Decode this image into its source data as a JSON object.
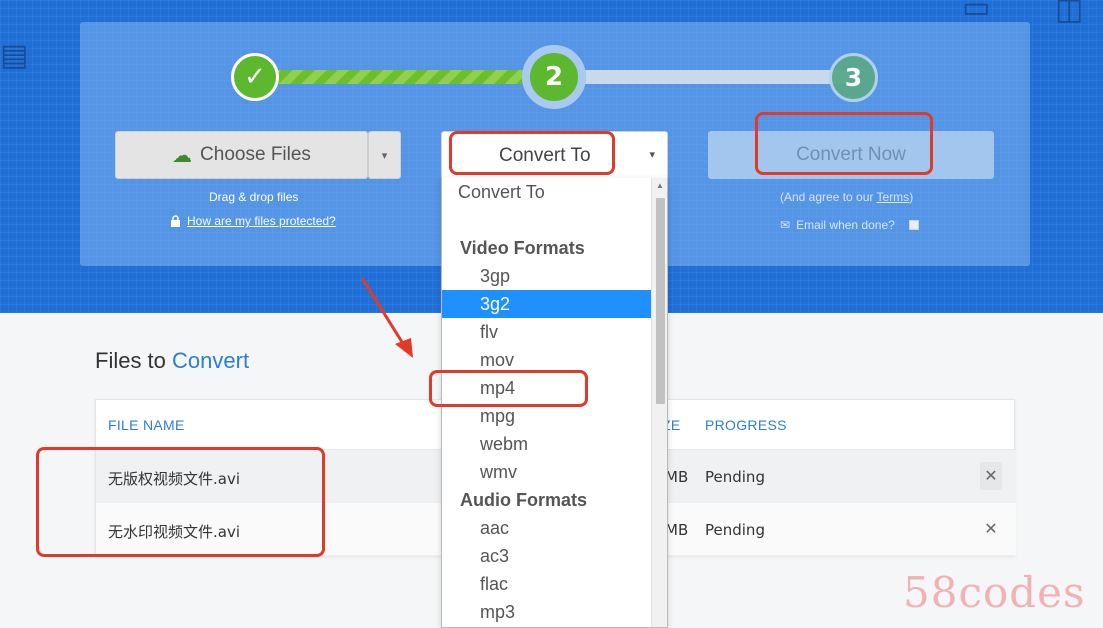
{
  "steps": {
    "step1": "✓",
    "step2": "2",
    "step3": "3"
  },
  "choose_files": {
    "label": "Choose Files",
    "caret": "▾"
  },
  "drag_drop": "Drag & drop files",
  "protected_link": "How are my files protected?",
  "convert_to": {
    "label": "Convert To",
    "caret": "▾"
  },
  "convert_now": "Convert Now",
  "agree": {
    "prefix": "(And agree to our ",
    "link": "Terms",
    "suffix": ")"
  },
  "email_when_done": "Email when done?",
  "dropdown": {
    "placeholder": "Convert To",
    "video_heading": "Video Formats",
    "video": [
      "3gp",
      "3g2",
      "flv",
      "mov",
      "mp4",
      "mpg",
      "webm",
      "wmv"
    ],
    "audio_heading": "Audio Formats",
    "audio": [
      "aac",
      "ac3",
      "flac",
      "mp3"
    ],
    "selected": "3g2"
  },
  "files_section": {
    "title_prefix": "Files to ",
    "title_accent": "Convert"
  },
  "table": {
    "headers": {
      "file_name": "FILE NAME",
      "size": "ZE",
      "progress": "PROGRESS"
    },
    "rows": [
      {
        "name": "无版权视频文件.avi",
        "size": "MB",
        "status": "Pending",
        "remove": "✕"
      },
      {
        "name": "无水印视频文件.avi",
        "size": "MB",
        "status": "Pending",
        "remove": "✕"
      }
    ]
  },
  "watermark": "58codes",
  "colors": {
    "hero_blue": "#1f6fd6",
    "accent": "#2d7fcf",
    "step_green": "#5cb82f",
    "selected": "#1e90ff",
    "annotation": "#e03a2a"
  }
}
